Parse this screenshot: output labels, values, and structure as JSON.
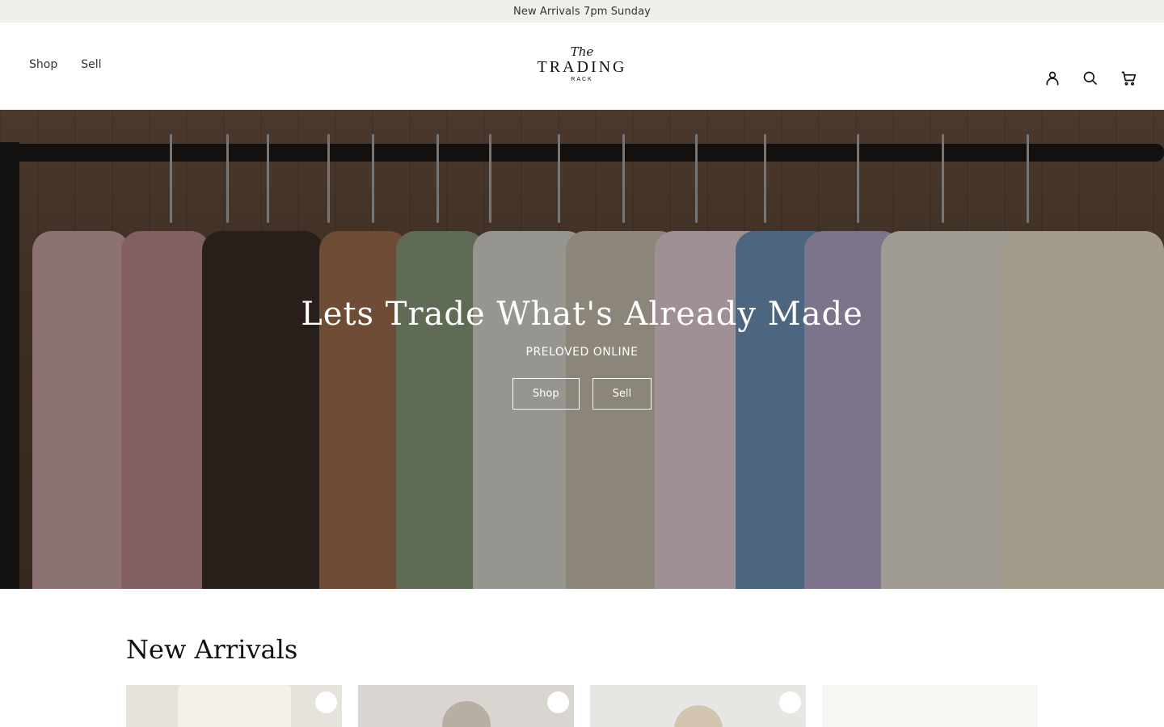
{
  "announcement": {
    "text": "New Arrivals 7pm Sunday"
  },
  "header": {
    "nav": [
      {
        "label": "Shop"
      },
      {
        "label": "Sell"
      }
    ],
    "logo": {
      "top": "The",
      "main": "TRADING",
      "bottom": "RACK"
    },
    "icons": [
      "account-icon",
      "search-icon",
      "cart-icon"
    ]
  },
  "hero": {
    "title": "Lets Trade What's Already Made",
    "subtitle": "PRELOVED ONLINE",
    "buttons": [
      {
        "label": "Shop"
      },
      {
        "label": "Sell"
      }
    ]
  },
  "new_arrivals": {
    "title": "New Arrivals"
  },
  "colors": {
    "announcement_bg": "#f1efea",
    "hero_overlay": "rgba(0,0,0,0.30)",
    "text_dark": "#111111"
  }
}
